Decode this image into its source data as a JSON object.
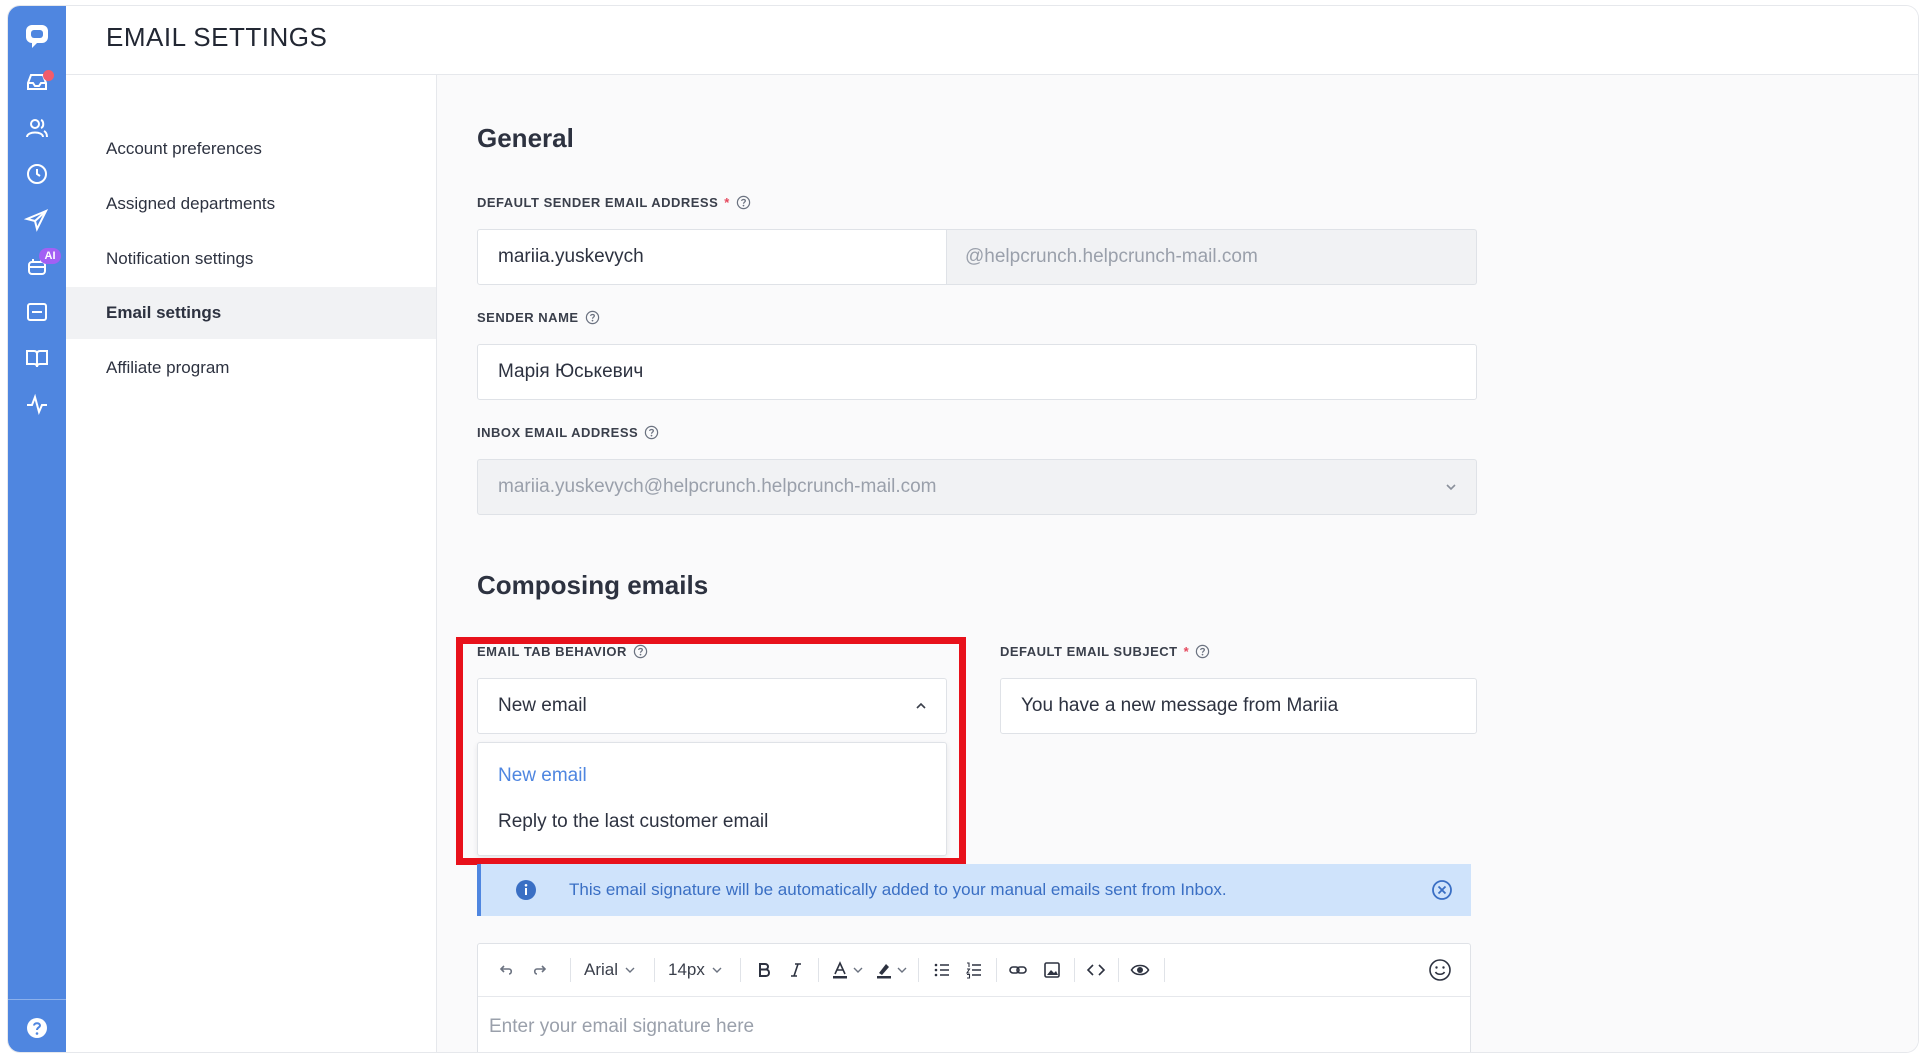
{
  "page": {
    "title": "EMAIL SETTINGS"
  },
  "rail": {
    "ai_badge": "AI",
    "icons": [
      "chat-logo-icon",
      "inbox-icon",
      "contacts-icon",
      "history-icon",
      "campaigns-icon",
      "ai-bot-icon",
      "widget-icon",
      "knowledge-base-icon",
      "activity-icon",
      "help-icon"
    ]
  },
  "nav": {
    "items": [
      {
        "label": "Account preferences"
      },
      {
        "label": "Assigned departments"
      },
      {
        "label": "Notification settings"
      },
      {
        "label": "Email settings"
      },
      {
        "label": "Affiliate program"
      }
    ]
  },
  "general": {
    "heading": "General",
    "sender_email": {
      "label": "DEFAULT SENDER EMAIL ADDRESS",
      "required": "*",
      "value": "mariia.yuskevych",
      "suffix": "@helpcrunch.helpcrunch-mail.com"
    },
    "sender_name": {
      "label": "SENDER NAME",
      "value": "Марія Юськевич"
    },
    "inbox_email": {
      "label": "INBOX EMAIL ADDRESS",
      "value": "mariia.yuskevych@helpcrunch.helpcrunch-mail.com"
    }
  },
  "composing": {
    "heading": "Composing emails",
    "tab_behavior": {
      "label": "EMAIL TAB BEHAVIOR",
      "value": "New email",
      "options": [
        "New email",
        "Reply to the last customer email"
      ]
    },
    "subject": {
      "label": "DEFAULT EMAIL SUBJECT",
      "required": "*",
      "value": "You have a new message from Mariia"
    },
    "info_text": "This email signature will be automatically added to your manual emails sent from Inbox.",
    "editor": {
      "font": "Arial",
      "size": "14px",
      "placeholder": "Enter your email signature here"
    }
  },
  "colors": {
    "accent": "#4f86e0",
    "highlight": "#e8111b",
    "info_bg": "#cfe3fb"
  }
}
